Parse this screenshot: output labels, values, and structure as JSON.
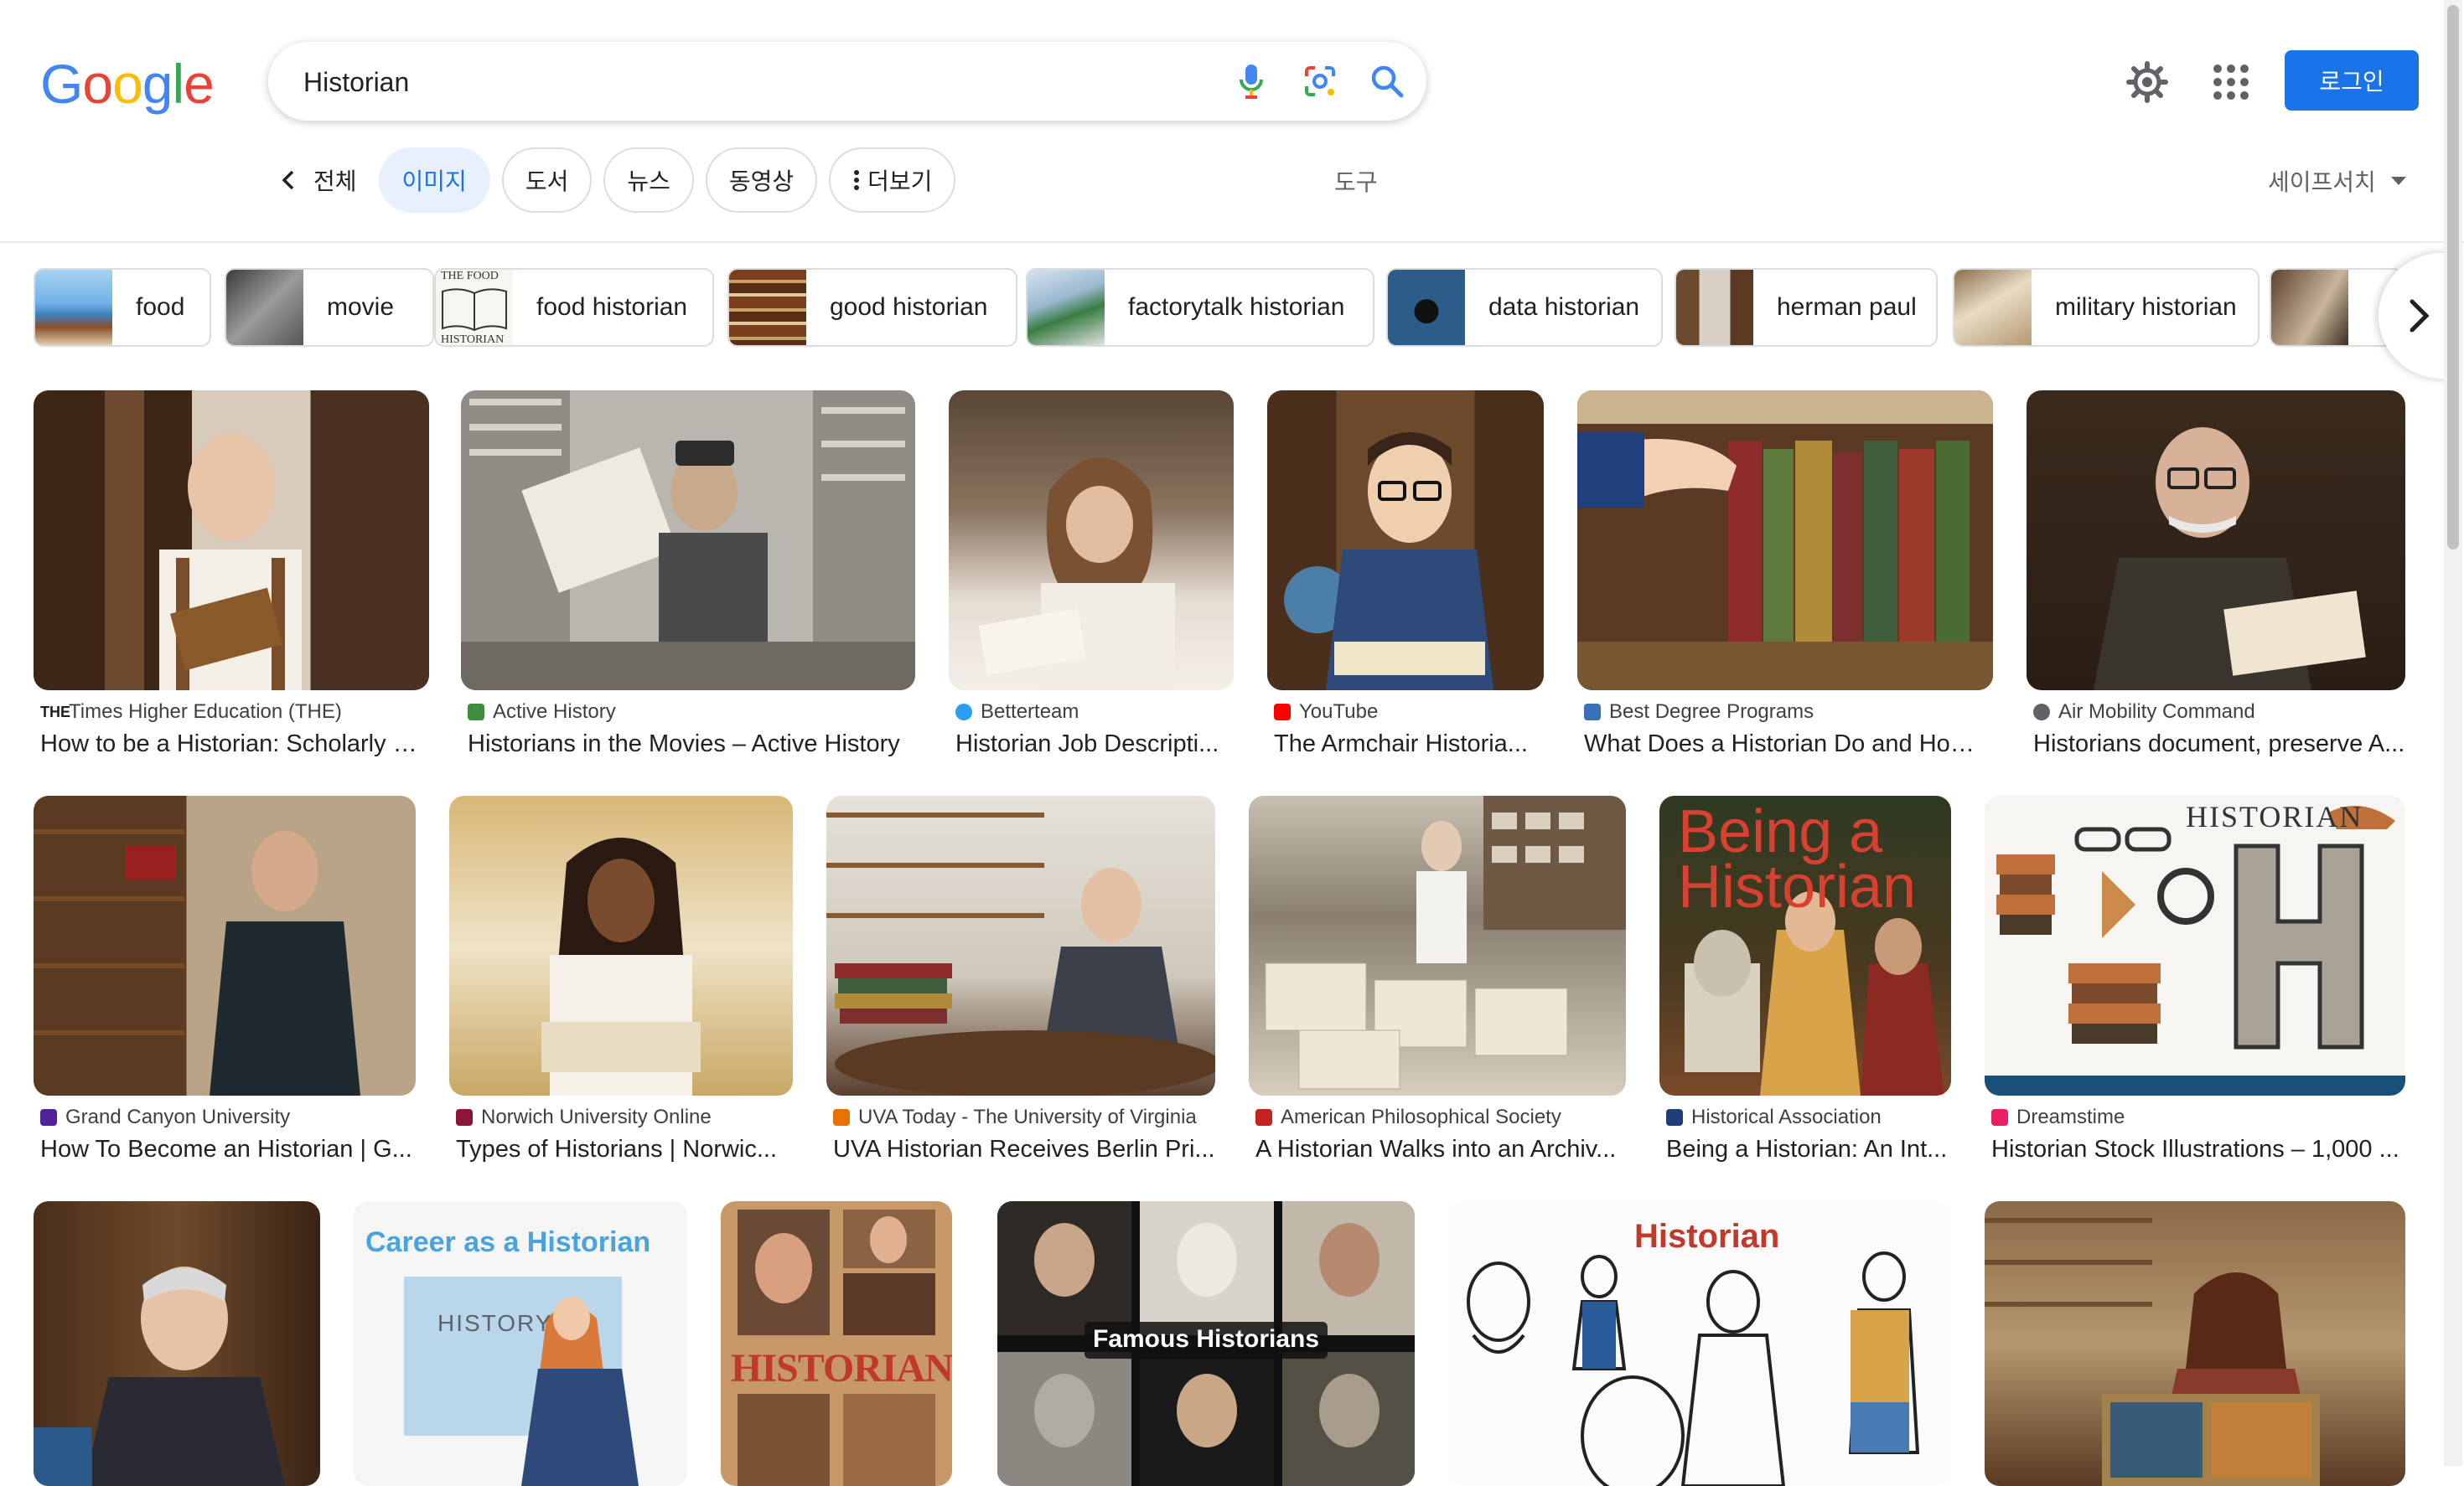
{
  "logo": {
    "text": "Google",
    "colors": [
      "#4285F4",
      "#EA4335",
      "#FBBC05",
      "#4285F4",
      "#34A853",
      "#EA4335"
    ]
  },
  "search": {
    "value": "Historian"
  },
  "header": {
    "login": "로그인"
  },
  "nav": {
    "tabs": [
      "전체",
      "이미지",
      "도서",
      "뉴스",
      "동영상",
      "더보기"
    ],
    "active": "이미지",
    "tools": "도구",
    "safesearch": "세이프서치"
  },
  "chips": [
    "food",
    "movie",
    "food historian",
    "good historian",
    "factorytalk historian",
    "data historian",
    "herman paul",
    "military historian"
  ],
  "results": [
    {
      "source": "Times Higher Education (THE)",
      "title": "How to be a Historian: Scholarly P...",
      "fav": "#202124"
    },
    {
      "source": "Active History",
      "title": "Historians in the Movies – Active History",
      "fav": "#3c8d3c"
    },
    {
      "source": "Betterteam",
      "title": "Historian Job Descripti...",
      "fav": "#2a9df4"
    },
    {
      "source": "YouTube",
      "title": "The Armchair Historia...",
      "fav": "#ff0000"
    },
    {
      "source": "Best Degree Programs",
      "title": "What Does a Historian Do and How ...",
      "fav": "#3b6fb6"
    },
    {
      "source": "Air Mobility Command",
      "title": "Historians document, preserve A...",
      "fav": "#5f6368"
    },
    {
      "source": "Grand Canyon University",
      "title": "How To Become an Historian | G...",
      "fav": "#522398"
    },
    {
      "source": "Norwich University Online",
      "title": "Types of Historians | Norwic...",
      "fav": "#8a1538"
    },
    {
      "source": "UVA Today - The University of Virginia",
      "title": "UVA Historian Receives Berlin Pri...",
      "fav": "#e57200"
    },
    {
      "source": "American Philosophical Society",
      "title": "A Historian Walks into an Archiv...",
      "fav": "#c5221f"
    },
    {
      "source": "Historical Association",
      "title": "Being a Historian: An Int...",
      "fav": "#1f3d7a"
    },
    {
      "source": "Dreamstime",
      "title": "Historian Stock Illustrations – 1,000 ...",
      "fav": "#e91e63"
    }
  ],
  "image_texts": {
    "being_historian": "Being a Historian",
    "dreamstime_title": "HISTORIAN",
    "career": "Career as a Historian",
    "history_board": "HISTORY",
    "movie_poster": "HISTORIAN",
    "famous": "Famous Historians",
    "historian_drawing": "Historian",
    "food_historian_top": "THE FOOD",
    "food_historian_bottom": "HISTORIAN"
  }
}
